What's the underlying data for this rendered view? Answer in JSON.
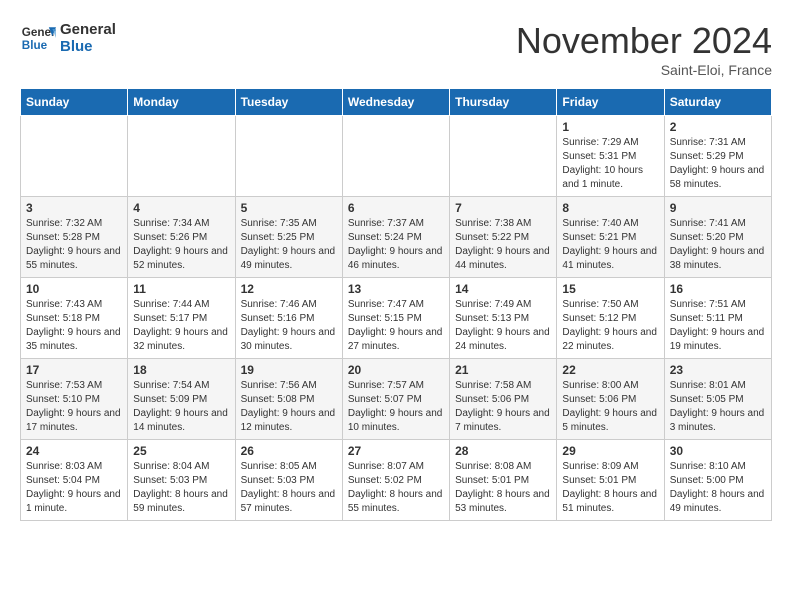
{
  "header": {
    "logo_line1": "General",
    "logo_line2": "Blue",
    "month": "November 2024",
    "location": "Saint-Eloi, France"
  },
  "weekdays": [
    "Sunday",
    "Monday",
    "Tuesday",
    "Wednesday",
    "Thursday",
    "Friday",
    "Saturday"
  ],
  "weeks": [
    [
      {
        "day": "",
        "info": ""
      },
      {
        "day": "",
        "info": ""
      },
      {
        "day": "",
        "info": ""
      },
      {
        "day": "",
        "info": ""
      },
      {
        "day": "",
        "info": ""
      },
      {
        "day": "1",
        "info": "Sunrise: 7:29 AM\nSunset: 5:31 PM\nDaylight: 10 hours and 1 minute."
      },
      {
        "day": "2",
        "info": "Sunrise: 7:31 AM\nSunset: 5:29 PM\nDaylight: 9 hours and 58 minutes."
      }
    ],
    [
      {
        "day": "3",
        "info": "Sunrise: 7:32 AM\nSunset: 5:28 PM\nDaylight: 9 hours and 55 minutes."
      },
      {
        "day": "4",
        "info": "Sunrise: 7:34 AM\nSunset: 5:26 PM\nDaylight: 9 hours and 52 minutes."
      },
      {
        "day": "5",
        "info": "Sunrise: 7:35 AM\nSunset: 5:25 PM\nDaylight: 9 hours and 49 minutes."
      },
      {
        "day": "6",
        "info": "Sunrise: 7:37 AM\nSunset: 5:24 PM\nDaylight: 9 hours and 46 minutes."
      },
      {
        "day": "7",
        "info": "Sunrise: 7:38 AM\nSunset: 5:22 PM\nDaylight: 9 hours and 44 minutes."
      },
      {
        "day": "8",
        "info": "Sunrise: 7:40 AM\nSunset: 5:21 PM\nDaylight: 9 hours and 41 minutes."
      },
      {
        "day": "9",
        "info": "Sunrise: 7:41 AM\nSunset: 5:20 PM\nDaylight: 9 hours and 38 minutes."
      }
    ],
    [
      {
        "day": "10",
        "info": "Sunrise: 7:43 AM\nSunset: 5:18 PM\nDaylight: 9 hours and 35 minutes."
      },
      {
        "day": "11",
        "info": "Sunrise: 7:44 AM\nSunset: 5:17 PM\nDaylight: 9 hours and 32 minutes."
      },
      {
        "day": "12",
        "info": "Sunrise: 7:46 AM\nSunset: 5:16 PM\nDaylight: 9 hours and 30 minutes."
      },
      {
        "day": "13",
        "info": "Sunrise: 7:47 AM\nSunset: 5:15 PM\nDaylight: 9 hours and 27 minutes."
      },
      {
        "day": "14",
        "info": "Sunrise: 7:49 AM\nSunset: 5:13 PM\nDaylight: 9 hours and 24 minutes."
      },
      {
        "day": "15",
        "info": "Sunrise: 7:50 AM\nSunset: 5:12 PM\nDaylight: 9 hours and 22 minutes."
      },
      {
        "day": "16",
        "info": "Sunrise: 7:51 AM\nSunset: 5:11 PM\nDaylight: 9 hours and 19 minutes."
      }
    ],
    [
      {
        "day": "17",
        "info": "Sunrise: 7:53 AM\nSunset: 5:10 PM\nDaylight: 9 hours and 17 minutes."
      },
      {
        "day": "18",
        "info": "Sunrise: 7:54 AM\nSunset: 5:09 PM\nDaylight: 9 hours and 14 minutes."
      },
      {
        "day": "19",
        "info": "Sunrise: 7:56 AM\nSunset: 5:08 PM\nDaylight: 9 hours and 12 minutes."
      },
      {
        "day": "20",
        "info": "Sunrise: 7:57 AM\nSunset: 5:07 PM\nDaylight: 9 hours and 10 minutes."
      },
      {
        "day": "21",
        "info": "Sunrise: 7:58 AM\nSunset: 5:06 PM\nDaylight: 9 hours and 7 minutes."
      },
      {
        "day": "22",
        "info": "Sunrise: 8:00 AM\nSunset: 5:06 PM\nDaylight: 9 hours and 5 minutes."
      },
      {
        "day": "23",
        "info": "Sunrise: 8:01 AM\nSunset: 5:05 PM\nDaylight: 9 hours and 3 minutes."
      }
    ],
    [
      {
        "day": "24",
        "info": "Sunrise: 8:03 AM\nSunset: 5:04 PM\nDaylight: 9 hours and 1 minute."
      },
      {
        "day": "25",
        "info": "Sunrise: 8:04 AM\nSunset: 5:03 PM\nDaylight: 8 hours and 59 minutes."
      },
      {
        "day": "26",
        "info": "Sunrise: 8:05 AM\nSunset: 5:03 PM\nDaylight: 8 hours and 57 minutes."
      },
      {
        "day": "27",
        "info": "Sunrise: 8:07 AM\nSunset: 5:02 PM\nDaylight: 8 hours and 55 minutes."
      },
      {
        "day": "28",
        "info": "Sunrise: 8:08 AM\nSunset: 5:01 PM\nDaylight: 8 hours and 53 minutes."
      },
      {
        "day": "29",
        "info": "Sunrise: 8:09 AM\nSunset: 5:01 PM\nDaylight: 8 hours and 51 minutes."
      },
      {
        "day": "30",
        "info": "Sunrise: 8:10 AM\nSunset: 5:00 PM\nDaylight: 8 hours and 49 minutes."
      }
    ]
  ]
}
